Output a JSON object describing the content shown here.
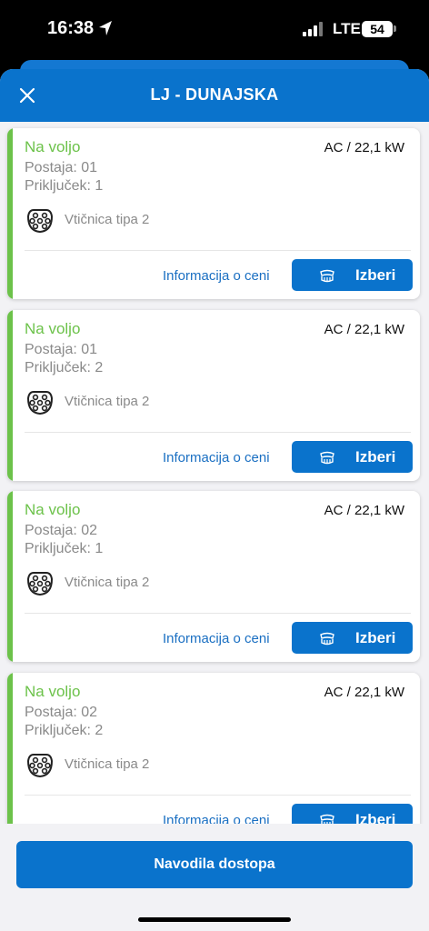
{
  "status_bar": {
    "time": "16:38",
    "network": "LTE",
    "battery": "54"
  },
  "header": {
    "title": "LJ - DUNAJSKA"
  },
  "cards": [
    {
      "status": "Na voljo",
      "power": "AC / 22,1 kW",
      "station": "Postaja: 01",
      "connector": "Priključek: 1",
      "plug_type": "Vtičnica tipa 2",
      "info_link": "Informacija o ceni",
      "select_label": "Izberi"
    },
    {
      "status": "Na voljo",
      "power": "AC / 22,1 kW",
      "station": "Postaja: 01",
      "connector": "Priključek: 2",
      "plug_type": "Vtičnica tipa 2",
      "info_link": "Informacija o ceni",
      "select_label": "Izberi"
    },
    {
      "status": "Na voljo",
      "power": "AC / 22,1 kW",
      "station": "Postaja: 02",
      "connector": "Priključek: 1",
      "plug_type": "Vtičnica tipa 2",
      "info_link": "Informacija o ceni",
      "select_label": "Izberi"
    },
    {
      "status": "Na voljo",
      "power": "AC / 22,1 kW",
      "station": "Postaja: 02",
      "connector": "Priključek: 2",
      "plug_type": "Vtičnica tipa 2",
      "info_link": "Informacija o ceni",
      "select_label": "Izberi"
    }
  ],
  "footer": {
    "button_label": "Navodila dostopa"
  },
  "colors": {
    "primary": "#0a73cc",
    "available": "#6cc24a",
    "link": "#1a6fc2"
  },
  "icons": {
    "close": "close-icon",
    "plug": "type2-plug-icon",
    "location": "location-arrow-icon"
  }
}
